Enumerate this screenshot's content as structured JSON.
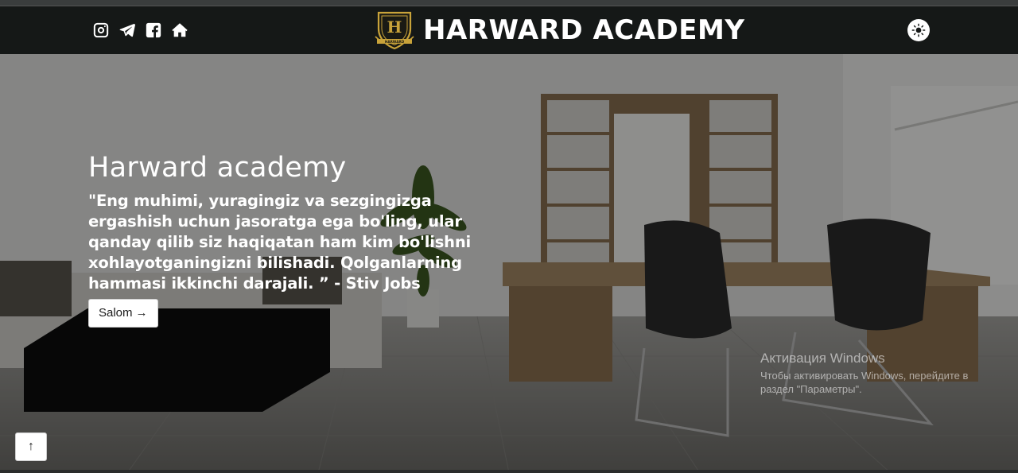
{
  "navbar": {
    "brand_title": "HARWARD ACADEMY",
    "logo_alt_text": "HARWARD",
    "social_icons": [
      "instagram-icon",
      "telegram-icon",
      "facebook-icon",
      "home-icon"
    ],
    "theme_icon": "sun-icon"
  },
  "hero": {
    "title": "Harward academy",
    "quote": "\"Eng muhimi, yuragingiz va sezgingizga ergashish uchun jasoratga ega bo'ling, ular qanday qilib siz haqiqatan ham kim bo'lishni xohlayotganingizni bilishadi. Qolganlarning hammasi ikkinchi darajali. ” - Stiv Jobs",
    "button_label": "Salom",
    "button_arrow": "→"
  },
  "scroll_top": {
    "arrow": "↑"
  },
  "os_watermark": {
    "line1": "Активация Windows",
    "line2": "Чтобы активировать Windows, перейдите в раздел \"Параметры\"."
  },
  "colors": {
    "navbar_bg": "#151817",
    "logo_gold": "#c9a33a",
    "text": "#ffffff"
  }
}
